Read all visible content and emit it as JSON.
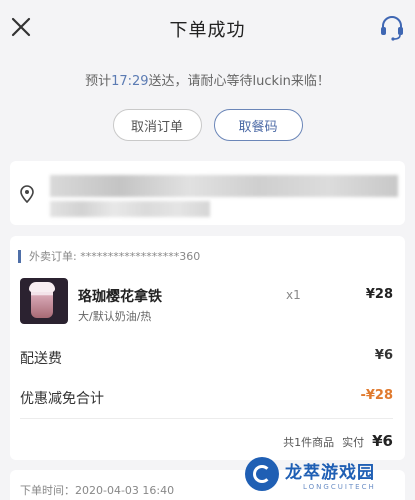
{
  "header": {
    "title": "下单成功"
  },
  "eta": {
    "prefix": "预计",
    "time": "17:29",
    "suffix": "送达，请耐心等待luckin来临！"
  },
  "actions": {
    "cancel_label": "取消订单",
    "pickup_label": "取餐码"
  },
  "order": {
    "number_label": "外卖订单: ******************360",
    "item": {
      "name": "珞珈樱花拿铁",
      "options": "大/默认奶油/热",
      "quantity": "x1",
      "price": "¥28"
    },
    "delivery_fee_label": "配送费",
    "delivery_fee": "¥6",
    "discount_label": "优惠减免合计",
    "discount": "-¥28",
    "item_count": "共1件商品",
    "paid_label": "实付",
    "paid": "¥6"
  },
  "order_time": "下单时间：2020-04-03 16:40",
  "watermark": {
    "main": "龙萃游戏园",
    "sub": "LONGCUITECH"
  },
  "colors": {
    "accent": "#5b7bb3",
    "discount": "#e07a2e",
    "background": "#f4f4f6"
  },
  "icons": [
    "close-icon",
    "headset-icon",
    "location-pin-icon"
  ]
}
